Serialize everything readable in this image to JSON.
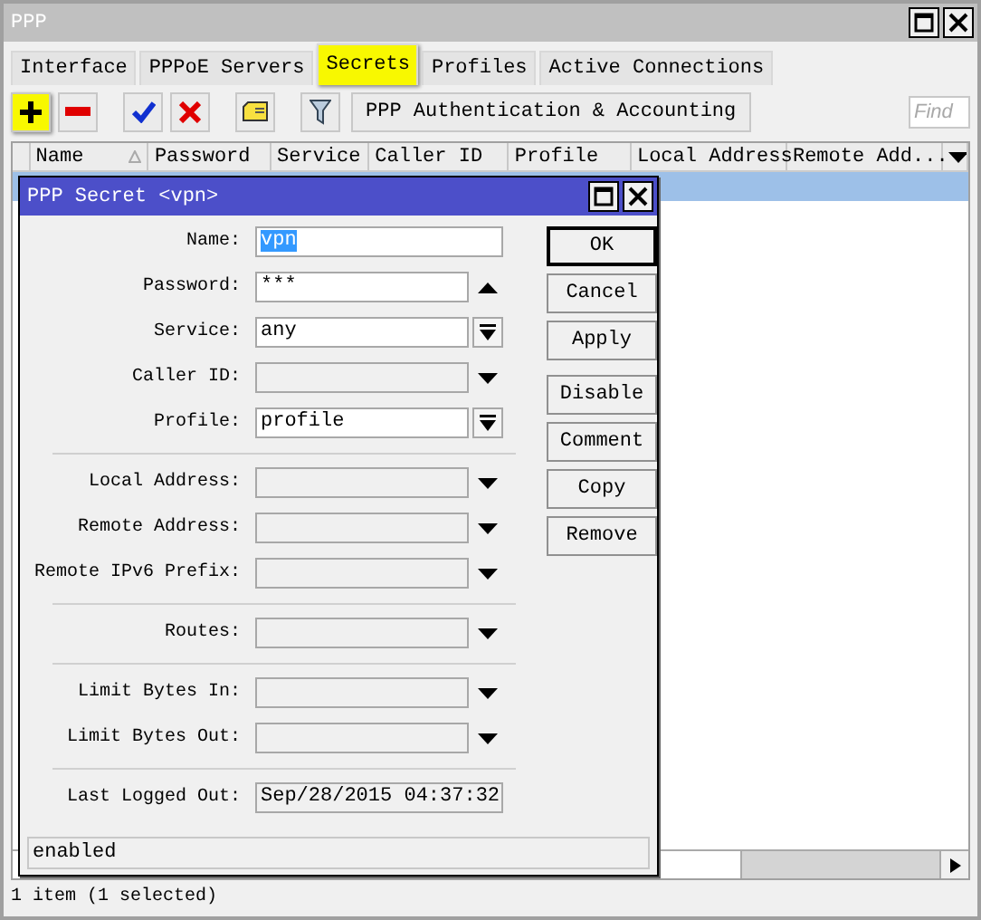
{
  "window": {
    "title": "PPP"
  },
  "tabs": [
    {
      "label": "Interface",
      "selected": false,
      "highlighted": false
    },
    {
      "label": "PPPoE Servers",
      "selected": false,
      "highlighted": false
    },
    {
      "label": "Secrets",
      "selected": true,
      "highlighted": true
    },
    {
      "label": "Profiles",
      "selected": false,
      "highlighted": false
    },
    {
      "label": "Active Connections",
      "selected": false,
      "highlighted": false
    }
  ],
  "toolbar": {
    "tools": [
      {
        "kind": "add",
        "highlighted": true
      },
      {
        "kind": "remove",
        "highlighted": false
      },
      {
        "kind": "enable",
        "highlighted": false
      },
      {
        "kind": "disable",
        "highlighted": false
      },
      {
        "kind": "comment",
        "highlighted": false
      },
      {
        "kind": "filter",
        "highlighted": false
      }
    ],
    "button": "PPP Authentication & Accounting",
    "find": {
      "placeholder": "Find"
    }
  },
  "table": {
    "columns": [
      "Name",
      "Password",
      "Service",
      "Caller ID",
      "Profile",
      "Local Address",
      "Remote Add..."
    ],
    "rows": [
      {
        "selected": true
      }
    ]
  },
  "status_bar": "1 item (1 selected)",
  "dialog": {
    "title": "PPP Secret <vpn>",
    "groups": [
      [
        {
          "label": "Name:",
          "value": "vpn",
          "kind": "text",
          "value_selected": true
        },
        {
          "label": "Password:",
          "value": "***",
          "kind": "password",
          "value_selected": false
        },
        {
          "label": "Service:",
          "value": "any",
          "kind": "select",
          "value_selected": false
        },
        {
          "label": "Caller ID:",
          "kind": "unset"
        },
        {
          "label": "Profile:",
          "value": "profile",
          "kind": "select",
          "value_selected": false
        }
      ],
      [
        {
          "label": "Local Address:",
          "kind": "unset"
        },
        {
          "label": "Remote Address:",
          "kind": "unset"
        },
        {
          "label": "Remote IPv6 Prefix:",
          "kind": "unset"
        }
      ],
      [
        {
          "label": "Routes:",
          "kind": "unset"
        }
      ],
      [
        {
          "label": "Limit Bytes In:",
          "kind": "unset"
        },
        {
          "label": "Limit Bytes Out:",
          "kind": "unset"
        }
      ],
      [
        {
          "label": "Last Logged Out:",
          "value": "Sep/28/2015 04:37:32",
          "kind": "readonly",
          "value_selected": false
        }
      ]
    ],
    "button_groups": [
      [
        {
          "label": "OK",
          "default": true
        },
        {
          "label": "Cancel",
          "default": false
        },
        {
          "label": "Apply",
          "default": false
        }
      ],
      [
        {
          "label": "Disable",
          "default": false
        },
        {
          "label": "Comment",
          "default": false
        },
        {
          "label": "Copy",
          "default": false
        },
        {
          "label": "Remove",
          "default": false
        }
      ]
    ],
    "status": "enabled"
  }
}
